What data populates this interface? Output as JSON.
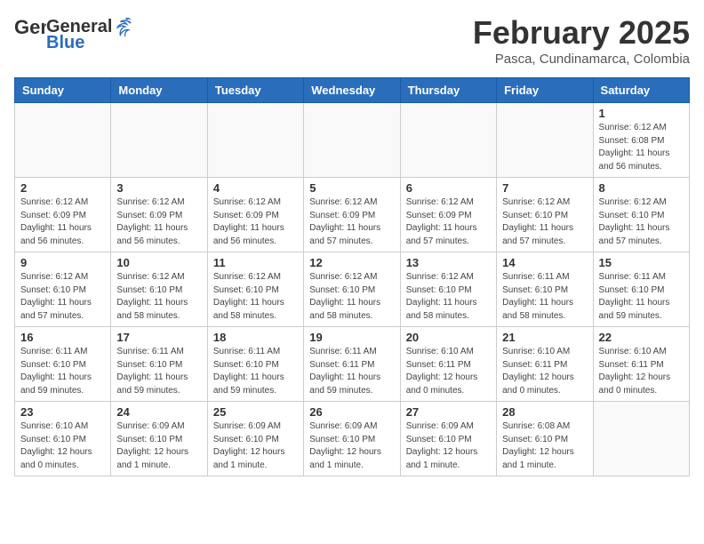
{
  "header": {
    "logo_general": "General",
    "logo_blue": "Blue",
    "month_title": "February 2025",
    "location": "Pasca, Cundinamarca, Colombia"
  },
  "weekdays": [
    "Sunday",
    "Monday",
    "Tuesday",
    "Wednesday",
    "Thursday",
    "Friday",
    "Saturday"
  ],
  "weeks": [
    [
      {
        "day": "",
        "info": ""
      },
      {
        "day": "",
        "info": ""
      },
      {
        "day": "",
        "info": ""
      },
      {
        "day": "",
        "info": ""
      },
      {
        "day": "",
        "info": ""
      },
      {
        "day": "",
        "info": ""
      },
      {
        "day": "1",
        "info": "Sunrise: 6:12 AM\nSunset: 6:08 PM\nDaylight: 11 hours\nand 56 minutes."
      }
    ],
    [
      {
        "day": "2",
        "info": "Sunrise: 6:12 AM\nSunset: 6:09 PM\nDaylight: 11 hours\nand 56 minutes."
      },
      {
        "day": "3",
        "info": "Sunrise: 6:12 AM\nSunset: 6:09 PM\nDaylight: 11 hours\nand 56 minutes."
      },
      {
        "day": "4",
        "info": "Sunrise: 6:12 AM\nSunset: 6:09 PM\nDaylight: 11 hours\nand 56 minutes."
      },
      {
        "day": "5",
        "info": "Sunrise: 6:12 AM\nSunset: 6:09 PM\nDaylight: 11 hours\nand 57 minutes."
      },
      {
        "day": "6",
        "info": "Sunrise: 6:12 AM\nSunset: 6:09 PM\nDaylight: 11 hours\nand 57 minutes."
      },
      {
        "day": "7",
        "info": "Sunrise: 6:12 AM\nSunset: 6:10 PM\nDaylight: 11 hours\nand 57 minutes."
      },
      {
        "day": "8",
        "info": "Sunrise: 6:12 AM\nSunset: 6:10 PM\nDaylight: 11 hours\nand 57 minutes."
      }
    ],
    [
      {
        "day": "9",
        "info": "Sunrise: 6:12 AM\nSunset: 6:10 PM\nDaylight: 11 hours\nand 57 minutes."
      },
      {
        "day": "10",
        "info": "Sunrise: 6:12 AM\nSunset: 6:10 PM\nDaylight: 11 hours\nand 58 minutes."
      },
      {
        "day": "11",
        "info": "Sunrise: 6:12 AM\nSunset: 6:10 PM\nDaylight: 11 hours\nand 58 minutes."
      },
      {
        "day": "12",
        "info": "Sunrise: 6:12 AM\nSunset: 6:10 PM\nDaylight: 11 hours\nand 58 minutes."
      },
      {
        "day": "13",
        "info": "Sunrise: 6:12 AM\nSunset: 6:10 PM\nDaylight: 11 hours\nand 58 minutes."
      },
      {
        "day": "14",
        "info": "Sunrise: 6:11 AM\nSunset: 6:10 PM\nDaylight: 11 hours\nand 58 minutes."
      },
      {
        "day": "15",
        "info": "Sunrise: 6:11 AM\nSunset: 6:10 PM\nDaylight: 11 hours\nand 59 minutes."
      }
    ],
    [
      {
        "day": "16",
        "info": "Sunrise: 6:11 AM\nSunset: 6:10 PM\nDaylight: 11 hours\nand 59 minutes."
      },
      {
        "day": "17",
        "info": "Sunrise: 6:11 AM\nSunset: 6:10 PM\nDaylight: 11 hours\nand 59 minutes."
      },
      {
        "day": "18",
        "info": "Sunrise: 6:11 AM\nSunset: 6:10 PM\nDaylight: 11 hours\nand 59 minutes."
      },
      {
        "day": "19",
        "info": "Sunrise: 6:11 AM\nSunset: 6:11 PM\nDaylight: 11 hours\nand 59 minutes."
      },
      {
        "day": "20",
        "info": "Sunrise: 6:10 AM\nSunset: 6:11 PM\nDaylight: 12 hours\nand 0 minutes."
      },
      {
        "day": "21",
        "info": "Sunrise: 6:10 AM\nSunset: 6:11 PM\nDaylight: 12 hours\nand 0 minutes."
      },
      {
        "day": "22",
        "info": "Sunrise: 6:10 AM\nSunset: 6:11 PM\nDaylight: 12 hours\nand 0 minutes."
      }
    ],
    [
      {
        "day": "23",
        "info": "Sunrise: 6:10 AM\nSunset: 6:10 PM\nDaylight: 12 hours\nand 0 minutes."
      },
      {
        "day": "24",
        "info": "Sunrise: 6:09 AM\nSunset: 6:10 PM\nDaylight: 12 hours\nand 1 minute."
      },
      {
        "day": "25",
        "info": "Sunrise: 6:09 AM\nSunset: 6:10 PM\nDaylight: 12 hours\nand 1 minute."
      },
      {
        "day": "26",
        "info": "Sunrise: 6:09 AM\nSunset: 6:10 PM\nDaylight: 12 hours\nand 1 minute."
      },
      {
        "day": "27",
        "info": "Sunrise: 6:09 AM\nSunset: 6:10 PM\nDaylight: 12 hours\nand 1 minute."
      },
      {
        "day": "28",
        "info": "Sunrise: 6:08 AM\nSunset: 6:10 PM\nDaylight: 12 hours\nand 1 minute."
      },
      {
        "day": "",
        "info": ""
      }
    ]
  ]
}
